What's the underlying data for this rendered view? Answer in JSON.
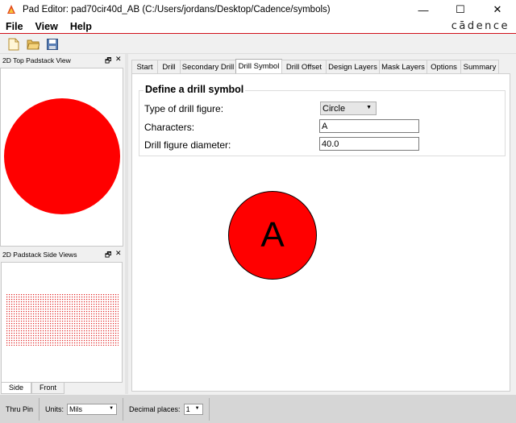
{
  "window": {
    "title": "Pad Editor: pad70cir40d_AB  (C:/Users/jordans/Desktop/Cadence/symbols)",
    "minimize": "—",
    "maximize": "☐",
    "close": "✕"
  },
  "menu": {
    "file": "File",
    "view": "View",
    "help": "Help",
    "brand": "cādence"
  },
  "toolbar": {
    "icons": [
      "new-file-icon",
      "open-folder-icon",
      "save-disk-icon"
    ]
  },
  "left": {
    "top_title": "2D Top Padstack View",
    "side_title": "2D Padstack Side Views",
    "float_glyph": "🗗",
    "close_glyph": "✕",
    "tabs": [
      "Side",
      "Front"
    ],
    "active_tab": "Side",
    "pad_color": "#ff0000"
  },
  "tabs": [
    "Start",
    "Drill",
    "Secondary Drill",
    "Drill Symbol",
    "Drill Offset",
    "Design Layers",
    "Mask Layers",
    "Options",
    "Summary"
  ],
  "active_tab": "Drill Symbol",
  "form": {
    "group_title": "Define a drill symbol",
    "figure_label": "Type of drill figure:",
    "figure_value": "Circle",
    "characters_label": "Characters:",
    "characters_value": "A",
    "diameter_label": "Drill figure diameter:",
    "diameter_value": "40.0"
  },
  "preview": {
    "char": "A",
    "fill": "#ff0000"
  },
  "status": {
    "type": "Thru Pin",
    "units_label": "Units:",
    "units_value": "Mils",
    "decimal_label": "Decimal places:",
    "decimal_value": "1"
  }
}
